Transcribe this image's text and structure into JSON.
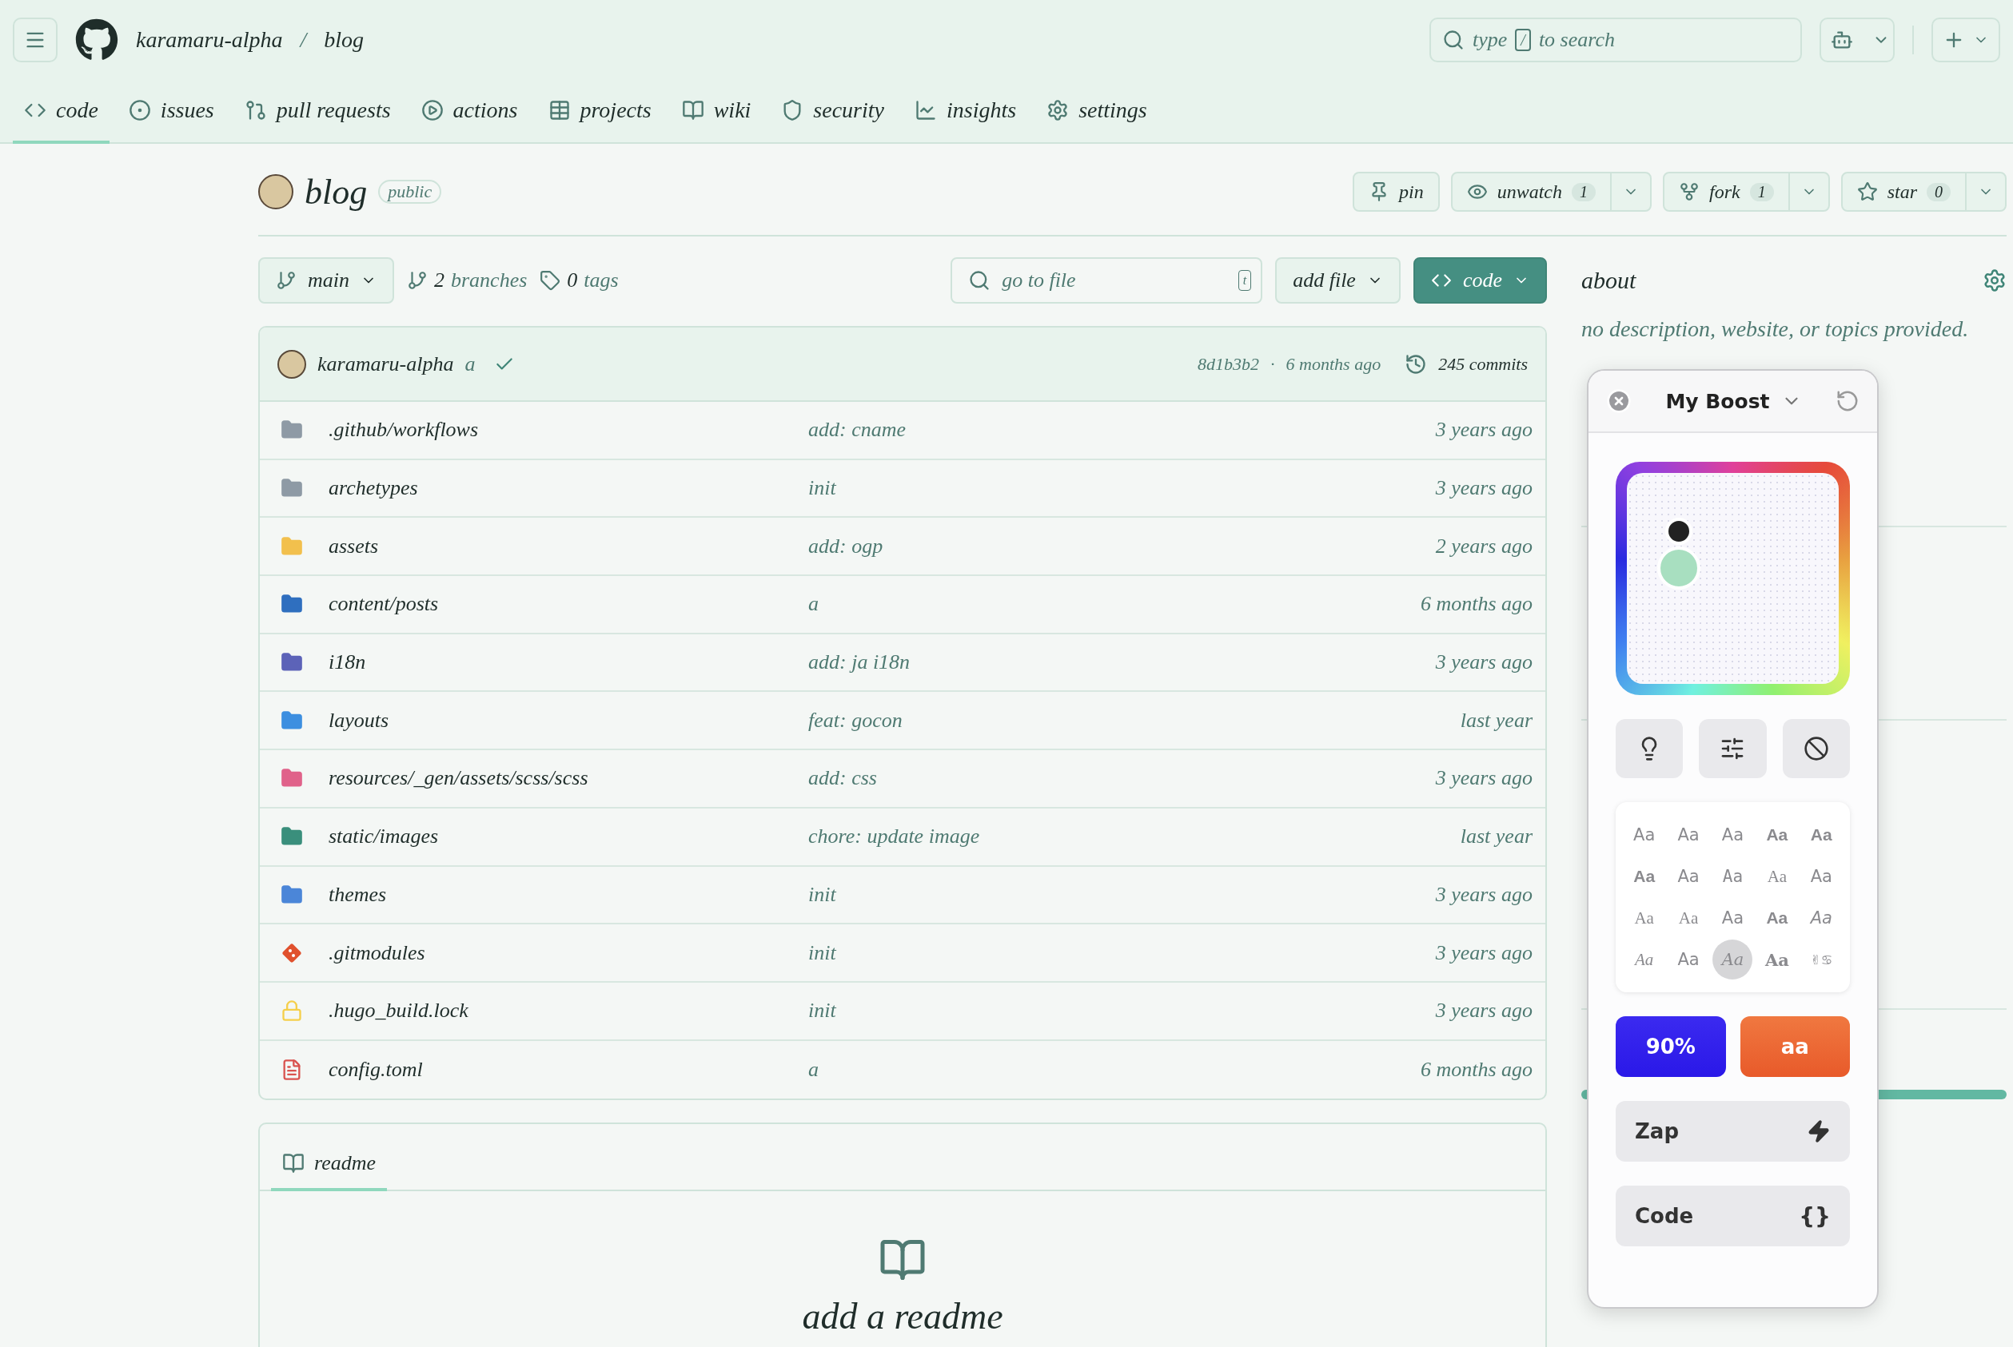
{
  "header": {
    "owner": "karamaru-alpha",
    "separator": "/",
    "repo": "blog",
    "search": {
      "before": "type",
      "key": "/",
      "after": "to search"
    }
  },
  "nav": [
    {
      "label": "code",
      "kind": "code",
      "selected": true
    },
    {
      "label": "issues",
      "kind": "issues",
      "selected": false
    },
    {
      "label": "pull requests",
      "kind": "pulls",
      "selected": false
    },
    {
      "label": "actions",
      "kind": "actions",
      "selected": false
    },
    {
      "label": "projects",
      "kind": "projects",
      "selected": false
    },
    {
      "label": "wiki",
      "kind": "wiki",
      "selected": false
    },
    {
      "label": "security",
      "kind": "security",
      "selected": false
    },
    {
      "label": "insights",
      "kind": "insights",
      "selected": false
    },
    {
      "label": "settings",
      "kind": "settings",
      "selected": false
    }
  ],
  "repo": {
    "name": "blog",
    "visibility": "public",
    "actions": [
      {
        "kind": "pin",
        "label": "pin"
      },
      {
        "kind": "watch",
        "label": "unwatch",
        "count": "1"
      },
      {
        "kind": "fork",
        "label": "fork",
        "count": "1"
      },
      {
        "kind": "star",
        "label": "star",
        "count": "0"
      }
    ]
  },
  "toolbar": {
    "branch": "main",
    "branches_count": "2",
    "branches_label": "branches",
    "tags_count": "0",
    "tags_label": "tags",
    "go_to_file": {
      "placeholder": "go to file",
      "key": "t"
    },
    "add_file": "add file",
    "code": "code"
  },
  "commit": {
    "author": "karamaru-alpha",
    "message": "a",
    "hash": "8d1b3b2",
    "separator": "·",
    "time": "6 months ago",
    "commits": "245 commits"
  },
  "files": [
    {
      "name": ".github/workflows",
      "message": "add: cname",
      "time": "3 years ago",
      "kind": "folder",
      "color": "#8e9aa5"
    },
    {
      "name": "archetypes",
      "message": "init",
      "time": "3 years ago",
      "kind": "folder",
      "color": "#8e9aa5"
    },
    {
      "name": "assets",
      "message": "add: ogp",
      "time": "2 years ago",
      "kind": "folder",
      "color": "#f2c04d"
    },
    {
      "name": "content/posts",
      "message": "a",
      "time": "6 months ago",
      "kind": "folder",
      "color": "#2f6fbf"
    },
    {
      "name": "i18n",
      "message": "add: ja i18n",
      "time": "3 years ago",
      "kind": "folder",
      "color": "#5c63b8"
    },
    {
      "name": "layouts",
      "message": "feat: gocon",
      "time": "last year",
      "kind": "folder",
      "color": "#3d8fe0"
    },
    {
      "name": "resources/_gen/assets/scss/scss",
      "message": "add: css",
      "time": "3 years ago",
      "kind": "folder",
      "color": "#e0628a"
    },
    {
      "name": "static/images",
      "message": "chore: update image",
      "time": "last year",
      "kind": "folder",
      "color": "#3a8f7c"
    },
    {
      "name": "themes",
      "message": "init",
      "time": "3 years ago",
      "kind": "folder",
      "color": "#4b86d8"
    },
    {
      "name": ".gitmodules",
      "message": "init",
      "time": "3 years ago",
      "kind": "git",
      "color": "#e0512d"
    },
    {
      "name": ".hugo_build.lock",
      "message": "init",
      "time": "3 years ago",
      "kind": "lock",
      "color": "#f5cf4a"
    },
    {
      "name": "config.toml",
      "message": "a",
      "time": "6 months ago",
      "kind": "toml",
      "color": "#d9534f"
    }
  ],
  "readme": {
    "tab": "readme",
    "heading": "add a readme"
  },
  "about": {
    "title": "about",
    "text": "no description, website, or topics provided."
  },
  "boost": {
    "title": "My Boost",
    "tools": [
      {
        "kind": "bulb"
      },
      {
        "kind": "sliders"
      },
      {
        "kind": "ban"
      }
    ],
    "fonts": [
      {
        "label": "Aa",
        "kind": "sans",
        "selected": false
      },
      {
        "label": "Aa",
        "kind": "sans",
        "selected": false
      },
      {
        "label": "Aa",
        "kind": "sans",
        "selected": false
      },
      {
        "label": "Aa",
        "kind": "sans-bold",
        "selected": false
      },
      {
        "label": "Aa",
        "kind": "sans-bold",
        "selected": false
      },
      {
        "label": "Aa",
        "kind": "sans-bold",
        "selected": false
      },
      {
        "label": "Aa",
        "kind": "sans",
        "selected": false
      },
      {
        "label": "Aa",
        "kind": "mono",
        "selected": false
      },
      {
        "label": "Aa",
        "kind": "serif",
        "selected": false
      },
      {
        "label": "Aa",
        "kind": "sans",
        "selected": false
      },
      {
        "label": "Aa",
        "kind": "serif",
        "selected": false
      },
      {
        "label": "Aa",
        "kind": "serif",
        "selected": false
      },
      {
        "label": "Aa",
        "kind": "sans",
        "selected": false
      },
      {
        "label": "Aa",
        "kind": "sans-bold",
        "selected": false
      },
      {
        "label": "Aa",
        "kind": "italic",
        "selected": false
      },
      {
        "label": "Aa",
        "kind": "script",
        "selected": false
      },
      {
        "label": "Aa",
        "kind": "sans",
        "selected": false
      },
      {
        "label": "Aa",
        "kind": "serif-italic",
        "selected": true
      },
      {
        "label": "Aa",
        "kind": "serif-bold",
        "selected": false
      },
      {
        "label": "✌♋",
        "kind": "symbol",
        "selected": false
      }
    ],
    "size": "90%",
    "case": "aa",
    "actions": [
      {
        "kind": "zap",
        "label": "Zap"
      },
      {
        "kind": "code",
        "label": "Code",
        "icon": "{}"
      }
    ]
  }
}
